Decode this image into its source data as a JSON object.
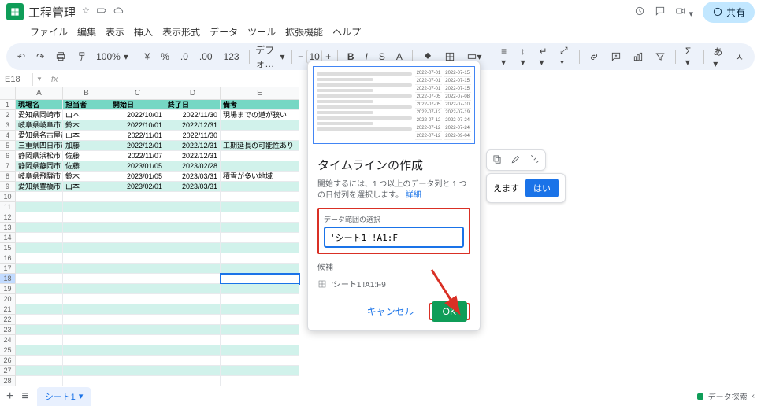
{
  "doc": {
    "title": "工程管理"
  },
  "menus": [
    "ファイル",
    "編集",
    "表示",
    "挿入",
    "表示形式",
    "データ",
    "ツール",
    "拡張機能",
    "ヘルプ"
  ],
  "toolbar": {
    "zoom": "100%",
    "font": "デフォ…",
    "size": "10",
    "yen": "¥",
    "pct": "%",
    "dec1": ".0",
    "dec2": ".00",
    "fmt": "123"
  },
  "share": "共有",
  "namebox": "E18",
  "columns": [
    "A",
    "B",
    "C",
    "D",
    "E"
  ],
  "headers": {
    "A": "現場名",
    "B": "担当者",
    "C": "開始日",
    "D": "終了日",
    "E": "備考"
  },
  "rows": [
    {
      "A": "愛知県岡崎市",
      "B": "山本",
      "C": "2022/10/01",
      "D": "2022/11/30",
      "E": "現場までの道が狭い"
    },
    {
      "A": "岐阜県岐阜市",
      "B": "鈴木",
      "C": "2022/10/01",
      "D": "2022/12/31",
      "E": ""
    },
    {
      "A": "愛知県名古屋市",
      "B": "山本",
      "C": "2022/11/01",
      "D": "2022/11/30",
      "E": ""
    },
    {
      "A": "三重県四日市市",
      "B": "加藤",
      "C": "2022/12/01",
      "D": "2022/12/31",
      "E": "工期延長の可能性あり"
    },
    {
      "A": "静岡県浜松市",
      "B": "佐藤",
      "C": "2022/11/07",
      "D": "2022/12/31",
      "E": ""
    },
    {
      "A": "静岡県静岡市",
      "B": "佐藤",
      "C": "2023/01/05",
      "D": "2023/02/28",
      "E": ""
    },
    {
      "A": "岐阜県飛騨市",
      "B": "鈴木",
      "C": "2023/01/05",
      "D": "2023/03/31",
      "E": "積雪が多い地域"
    },
    {
      "A": "愛知県豊橋市",
      "B": "山本",
      "C": "2023/02/01",
      "D": "2023/03/31",
      "E": ""
    }
  ],
  "modal": {
    "title": "タイムラインの作成",
    "desc": "開始するには、1 つ以上のデータ列と 1 つの日付列を選択します。",
    "desc_link": "詳細",
    "range_label": "データ範囲の選択",
    "range_value": "'シート1'!A1:F",
    "cand_label": "候補",
    "cand_item": "'シート1'!A1:F9",
    "cancel": "キャンセル",
    "ok": "OK",
    "preview_dates": {
      "col1": [
        "2022-07-01",
        "2022-07-01",
        "2022-07-01",
        "2022-07-05",
        "2022-07-05",
        "2022-07-12",
        "2022-07-12",
        "2022-07-12",
        "2022-07-12"
      ],
      "col2": [
        "2022-07-15",
        "2022-07-15",
        "2022-07-15",
        "2022-07-08",
        "2022-07-10",
        "2022-07-19",
        "2022-07-24",
        "2022-07-24",
        "2022-09-04"
      ]
    }
  },
  "suggest": {
    "text": "えます",
    "yes": "はい"
  },
  "sheet_tab": "シート1",
  "bottom_right": "データ探索"
}
